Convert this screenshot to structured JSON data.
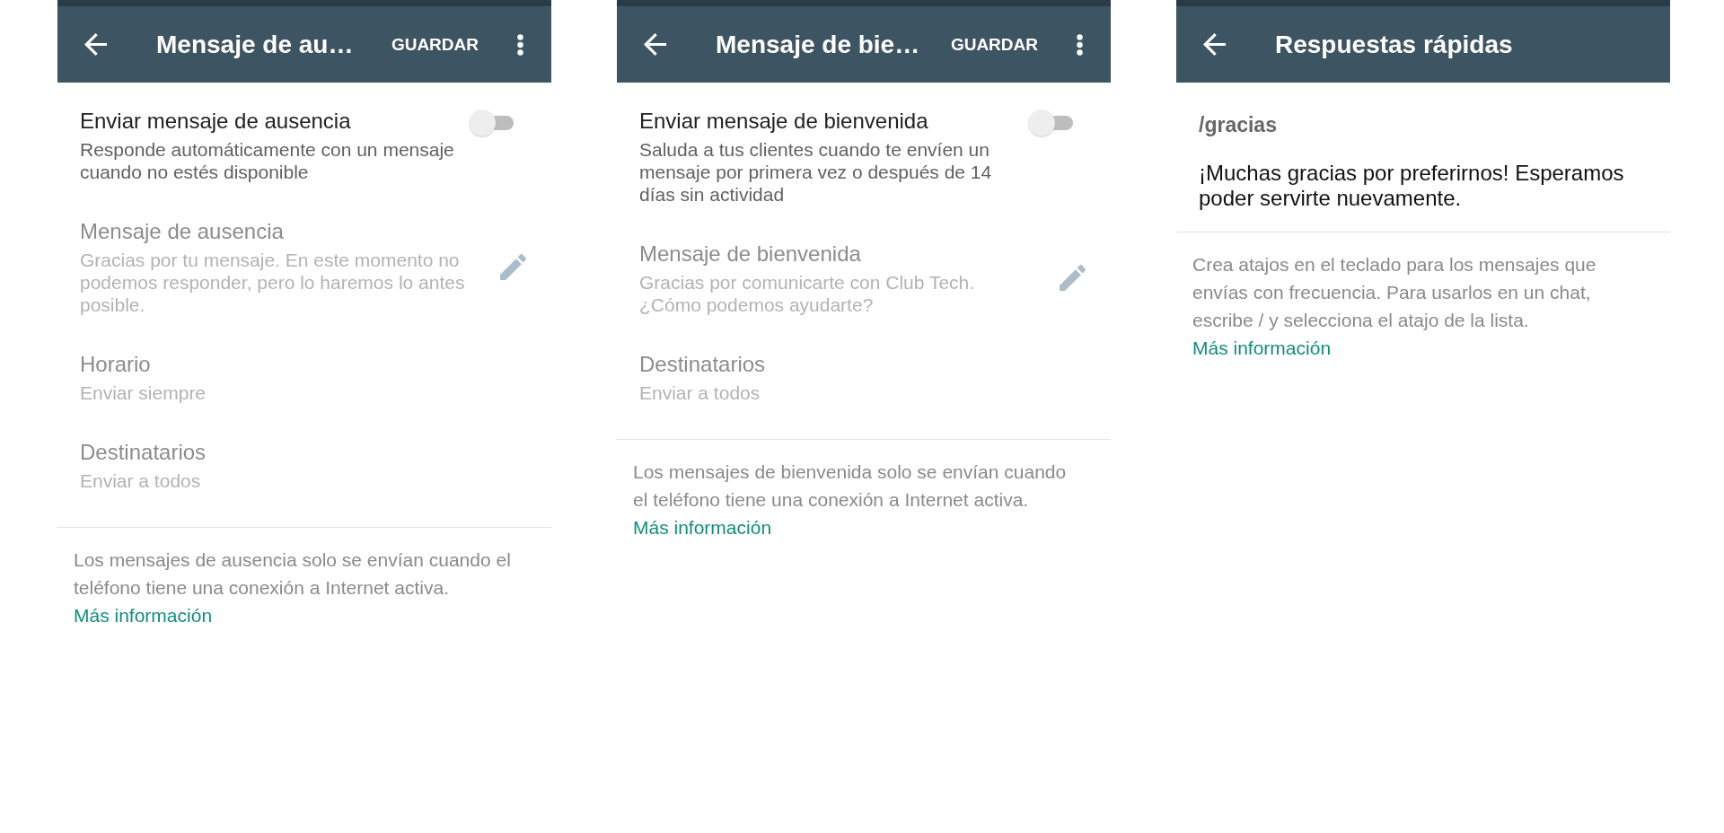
{
  "screens": [
    {
      "app_bar": {
        "title": "Mensaje de au…",
        "action": "GUARDAR",
        "overflow_menu": true
      },
      "items": [
        {
          "kind": "toggle",
          "title": "Enviar mensaje de ausencia",
          "subtitle": "Responde automáticamente con un mensaje cuando no estés disponible",
          "on": false,
          "disabled": false
        },
        {
          "kind": "editable",
          "title": "Mensaje de ausencia",
          "text": "Gracias por tu mensaje. En este momento no podemos responder, pero lo haremos lo antes posible.",
          "disabled": true
        },
        {
          "kind": "value",
          "title": "Horario",
          "value": "Enviar siempre",
          "disabled": true
        },
        {
          "kind": "value",
          "title": "Destinatarios",
          "value": "Enviar a todos",
          "disabled": true
        }
      ],
      "note": {
        "text": "Los mensajes de ausencia solo se envían cuando el teléfono tiene una conexión a Internet activa.",
        "link": "Más información"
      }
    },
    {
      "app_bar": {
        "title": "Mensaje de bie…",
        "action": "GUARDAR",
        "overflow_menu": true
      },
      "items": [
        {
          "kind": "toggle",
          "title": "Enviar mensaje de bienvenida",
          "subtitle": "Saluda a tus clientes cuando te envíen un mensaje por primera vez o después de 14 días sin actividad",
          "on": false,
          "disabled": false
        },
        {
          "kind": "editable",
          "title": "Mensaje de bienvenida",
          "text": "Gracias por comunicarte con Club Tech. ¿Cómo podemos ayudarte?",
          "disabled": true
        },
        {
          "kind": "value",
          "title": "Destinatarios",
          "value": "Enviar a todos",
          "disabled": true
        }
      ],
      "note": {
        "text": "Los mensajes de bienvenida solo se envían cuando el teléfono tiene una conexión a Internet activa.",
        "link": "Más información"
      }
    },
    {
      "app_bar": {
        "title": "Respuestas rápidas",
        "overflow_menu": false
      },
      "items": [
        {
          "kind": "quick_reply",
          "shortcut": "/gracias",
          "message": "¡Muchas gracias por preferirnos! Esperamos poder servirte nuevamente."
        }
      ],
      "note": {
        "text": "Crea atajos en el teclado para los mensajes que envías con frecuencia. Para usarlos en un chat, escribe / y selecciona el atajo de la lista.",
        "link": "Más información"
      }
    }
  ]
}
